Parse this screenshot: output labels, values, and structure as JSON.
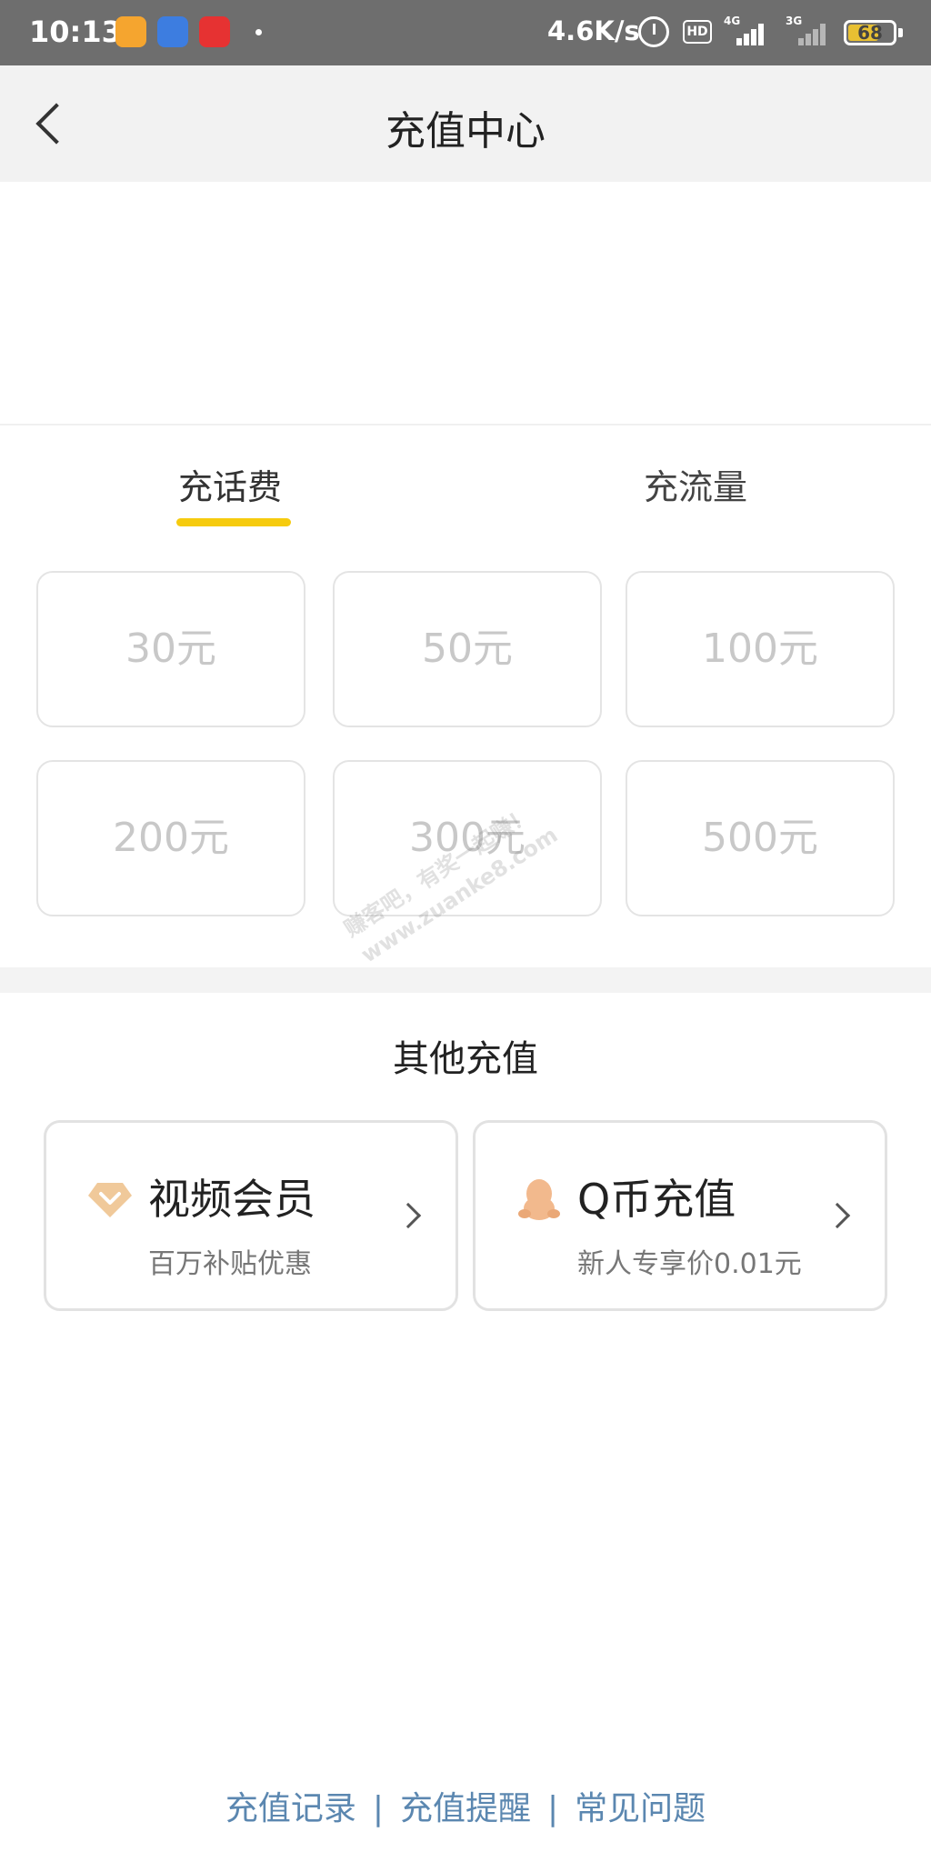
{
  "status_bar": {
    "time": "10:13",
    "network_speed": "4.6K/s",
    "hd_label": "HD",
    "signal1_label": "4G",
    "signal2_label": "3G",
    "battery_level": "68"
  },
  "header": {
    "title": "充值中心"
  },
  "tabs": [
    {
      "label": "充话费",
      "active": true
    },
    {
      "label": "充流量",
      "active": false
    }
  ],
  "amounts": [
    "30元",
    "50元",
    "100元",
    "200元",
    "300元",
    "500元"
  ],
  "other_section": {
    "title": "其他充值",
    "cards": [
      {
        "title": "视频会员",
        "subtitle": "百万补贴优惠",
        "icon": "diamond-icon"
      },
      {
        "title": "Q币充值",
        "subtitle": "新人专享价0.01元",
        "icon": "qq-penguin-icon"
      }
    ]
  },
  "footer": {
    "links": [
      "充值记录",
      "充值提醒",
      "常见问题"
    ],
    "separator": "|"
  },
  "watermark": {
    "line1": "赚客吧，有奖一起赚！",
    "line2": "www.zuanke8.com"
  },
  "colors": {
    "accent": "#f6cb0e",
    "link": "#5b87b0",
    "disabled_text": "#c8c8c8"
  }
}
